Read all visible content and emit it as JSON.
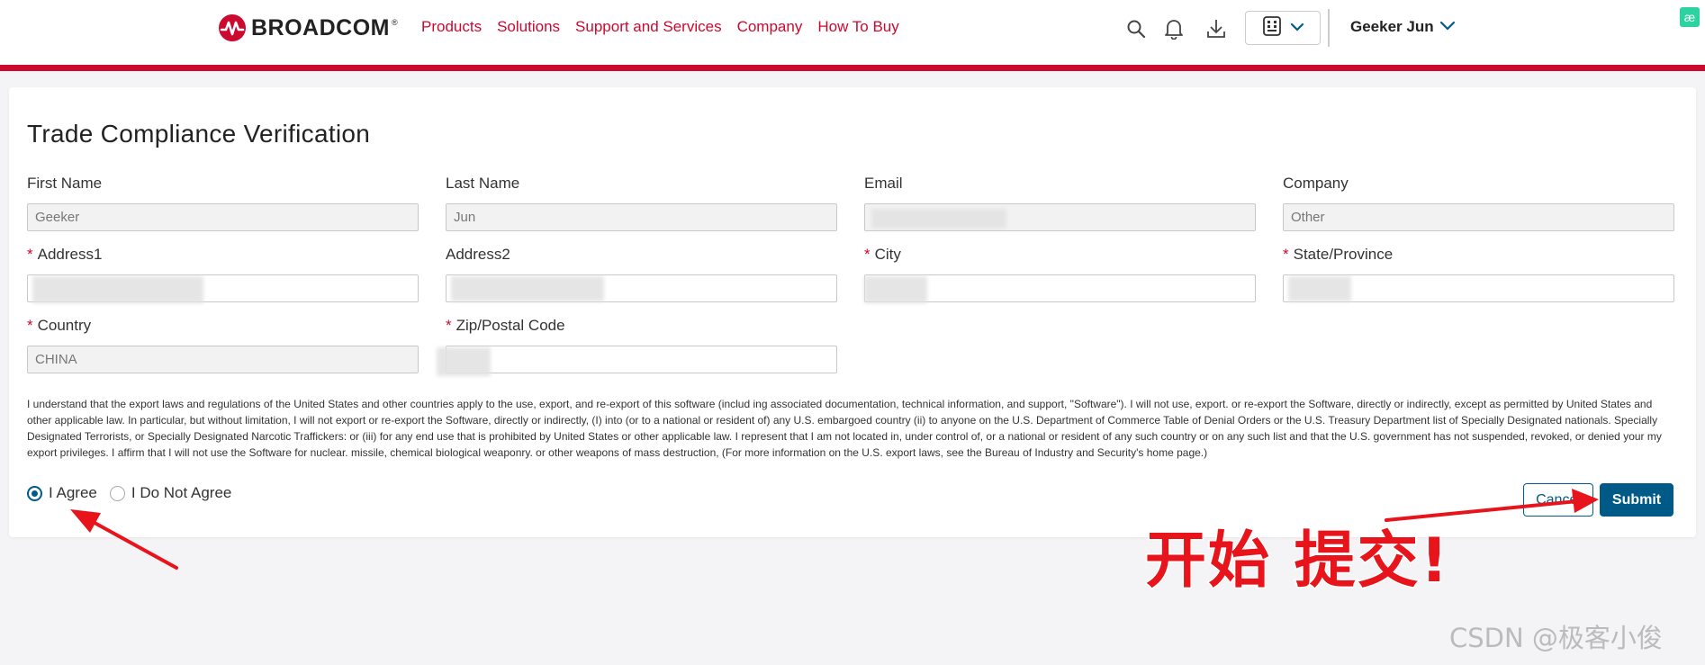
{
  "header": {
    "logo_text": "BROADCOM",
    "nav": [
      "Products",
      "Solutions",
      "Support and Services",
      "Company",
      "How To Buy"
    ],
    "user_name": "Geeker Jun",
    "extension_badge": "æ"
  },
  "page_title": "Trade Compliance Verification",
  "fields": {
    "first_name": {
      "label": "First Name",
      "value": "Geeker"
    },
    "last_name": {
      "label": "Last Name",
      "value": "Jun"
    },
    "email": {
      "label": "Email",
      "value": ""
    },
    "company": {
      "label": "Company",
      "value": "Other"
    },
    "address1": {
      "label": "Address1",
      "required": "*",
      "value": ""
    },
    "address2": {
      "label": "Address2",
      "value": ""
    },
    "city": {
      "label": "City",
      "required": "*",
      "value": ""
    },
    "state": {
      "label": "State/Province",
      "required": "*",
      "value": ""
    },
    "country": {
      "label": "Country",
      "required": "*",
      "value": "CHINA"
    },
    "zip": {
      "label": "Zip/Postal Code",
      "required": "*",
      "value": ""
    }
  },
  "disclaimer": "I understand that the export laws and regulations of the United States and other countries apply to the use, export, and re-export of this software (includ ing associated documentation, technical information, and support, \"Software\"). I will not use, export. or re-export the Software, directly or indirectly, except as permitted by United States and other applicable law. In particular, but without limitation, I will not export or re-export the Software, directly or indirectly, (I) into (or to a national or resident of) any U.S. embargoed country (ii) to anyone on the U.S. Department of Commerce Table of Denial Orders or the U.S. Treasury Department list of Specially Designated nationals. Specially Designated Terrorists, or Specially Designated Narcotic Traffickers: or (iii) for any end use that is prohibited by United States or other applicable law. I represent that I am not located in, under control of, or a national or resident of any such country or on any such list and that the U.S. government has not suspended, revoked, or denied your my export privileges. I affirm that I will not use the Software for nuclear. missile, chemical biological weaponry. or other weapons of mass destruction, (For more information on the U.S. export laws, see the Bureau of Industry and Security's home page.)",
  "agreement": {
    "agree_label": "I Agree",
    "disagree_label": "I Do Not Agree",
    "selected": "agree"
  },
  "buttons": {
    "cancel": "Cancel",
    "submit": "Submit"
  },
  "annotation": {
    "text": "开始 提交!",
    "color": "#e8141b"
  },
  "watermark": "CSDN @极客小俊",
  "colors": {
    "brand_red": "#cc092f",
    "primary_blue": "#005a87"
  }
}
